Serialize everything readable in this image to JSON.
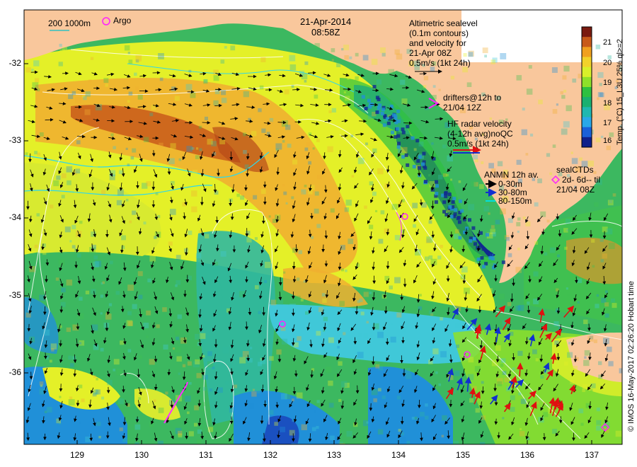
{
  "header": {
    "date": "21-Apr-2014",
    "time": "08:58Z"
  },
  "scale_bar": {
    "label": "200  1000m"
  },
  "argo_label": "Argo",
  "altimetry": {
    "lines": [
      "Altimetric sealevel",
      "(0.1m contours)",
      "and velocity for",
      "21-Apr 08Z",
      "0.5m/s (1kt 24h)"
    ]
  },
  "drifters": {
    "symbol": ">",
    "lines": [
      "drifters@12h to",
      "21/04 12Z"
    ]
  },
  "hf_radar": {
    "lines": [
      "HF radar velocity",
      "(4-12h avg)noQC",
      "0.5m/s (1kt 24h)"
    ]
  },
  "anmn": {
    "title": "ANMN 12h av.",
    "legend": [
      {
        "label": "0-30m",
        "color": "#000000"
      },
      {
        "label": "30-80m",
        "color": "#0000ff"
      },
      {
        "label": "80-150m",
        "color": "#00e0e0"
      }
    ]
  },
  "seal": {
    "lines": [
      "sealCTDs",
      "2d- 6d-- til",
      "21/04 08Z"
    ]
  },
  "colorbar": {
    "title": "Temp. (°C) 15_L3U 25% ql>=2",
    "ticks": [
      "21",
      "20",
      "19",
      "18",
      "17",
      "16"
    ],
    "colors": [
      "#7a1a10",
      "#c85a1a",
      "#f0a020",
      "#f2d22a",
      "#d8f02a",
      "#8ee02a",
      "#2ec040",
      "#1ab070",
      "#20b8b0",
      "#2aa8e8",
      "#1a60d8",
      "#10208a"
    ]
  },
  "axes": {
    "y_ticks": [
      "-32",
      "-33",
      "-34",
      "-35",
      "-36"
    ],
    "x_ticks": [
      "129",
      "130",
      "131",
      "132",
      "133",
      "134",
      "135",
      "136",
      "137"
    ]
  },
  "copyright": "© IMOS 16-May-2017 02:26:20 Hobart time",
  "map_colors": {
    "land": "#f9c79c",
    "warm": "#f0b030",
    "hot": "#c85a1a",
    "yellow": "#e4f028",
    "green": "#40c050",
    "teal": "#30b8a0",
    "cyan": "#40c8d8",
    "blue": "#2090d8",
    "navy": "#102890"
  }
}
